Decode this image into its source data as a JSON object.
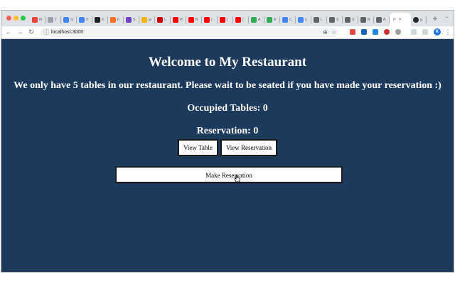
{
  "browser": {
    "tabs": [
      {
        "icon": "gmail-icon",
        "color": "#ea4335",
        "letter": "M"
      },
      {
        "icon": "tab-icon",
        "color": "#9aa0a6",
        "letter": "T"
      },
      {
        "icon": "google-icon",
        "color": "#4285f4",
        "letter": "G"
      },
      {
        "icon": "google-icon",
        "color": "#4285f4",
        "letter": "9"
      },
      {
        "icon": "tab-icon",
        "color": "#202124",
        "letter": "K"
      },
      {
        "icon": "gitlab-icon",
        "color": "#fc6d26",
        "letter": "F"
      },
      {
        "icon": "tab-icon",
        "color": "#6f42c1",
        "letter": "S"
      },
      {
        "icon": "tab-icon",
        "color": "#f4b400",
        "letter": "ja"
      },
      {
        "icon": "tab-icon",
        "color": "#cc0000",
        "letter": "L"
      },
      {
        "icon": "youtube-icon",
        "color": "#ff0000",
        "letter": "H"
      },
      {
        "icon": "youtube-icon",
        "color": "#ff0000",
        "letter": "B"
      },
      {
        "icon": "youtube-icon",
        "color": "#ff0000",
        "letter": "("
      },
      {
        "icon": "youtube-icon",
        "color": "#ff0000",
        "letter": "("
      },
      {
        "icon": "youtube-icon",
        "color": "#ff0000",
        "letter": "("
      },
      {
        "icon": "tab-icon",
        "color": "#34a853",
        "letter": "A"
      },
      {
        "icon": "tab-icon",
        "color": "#34a853",
        "letter": "A"
      },
      {
        "icon": "tab-icon",
        "color": "#4285f4",
        "letter": "C"
      },
      {
        "icon": "tab-icon",
        "color": "#4285f4",
        "letter": "C"
      },
      {
        "icon": "tab-icon",
        "color": "#5f6368",
        "letter": "L"
      },
      {
        "icon": "tab-icon",
        "color": "#5f6368",
        "letter": "S"
      },
      {
        "icon": "tab-icon",
        "color": "#5f6368",
        "letter": "S"
      },
      {
        "icon": "tab-icon",
        "color": "#5f6368",
        "letter": "B"
      },
      {
        "icon": "tab-icon",
        "color": "#5f6368",
        "letter": "A"
      }
    ],
    "active_tab": {
      "letter": "H",
      "close": "×"
    },
    "github_tab": {
      "letter": "g"
    },
    "newtab_label": "+",
    "url": "localhost:3000",
    "profile_initial": "K"
  },
  "page": {
    "title": "Welcome to My Restaurant",
    "subtitle": "We only have 5 tables in our restaurant. Please wait to be seated if you have made your reservation :)",
    "occupied_label": "Occupied Tables: 0",
    "reservation_label": "Reservation: 0",
    "view_table_button": "View Table",
    "view_reservation_button": "View Reservation",
    "make_reservation_button": "Make Reservation",
    "background_color": "#1b3a5c"
  }
}
